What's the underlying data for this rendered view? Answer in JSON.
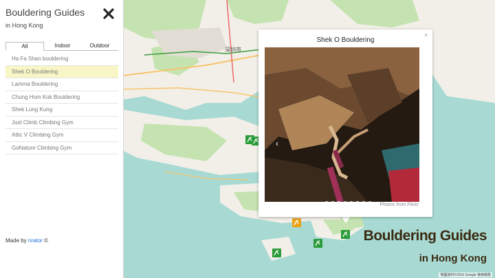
{
  "sidebar": {
    "title": "Bouldering Guides",
    "subtitle": "in Hong Kong",
    "tabs": [
      {
        "label": "All",
        "active": true
      },
      {
        "label": "Indoor",
        "active": false
      },
      {
        "label": "Outdoor",
        "active": false
      }
    ],
    "items": [
      {
        "label": "Ha Fa Shan bouldering",
        "selected": false
      },
      {
        "label": "Shek O Bouldering",
        "selected": true
      },
      {
        "label": "Lamma Bouldering",
        "selected": false
      },
      {
        "label": "Chung Hom Kok Bouldering",
        "selected": false
      },
      {
        "label": "Shek Lung Kung",
        "selected": false
      },
      {
        "label": "Just Climb Climbing Gym",
        "selected": false
      },
      {
        "label": "Attic V Climbing Gym",
        "selected": false
      },
      {
        "label": "GoNature Climbing Gym",
        "selected": false
      }
    ],
    "footer": {
      "prefix": "Made by",
      "author": "nrator",
      "suffix": "©"
    }
  },
  "map": {
    "city_label": "深圳市",
    "brand_title": "Bouldering Guides",
    "brand_subtitle": "in Hong Kong",
    "attribution": "地圖資料©2016 Google   使用條款"
  },
  "popup": {
    "title": "Shek O Bouldering",
    "close_label": "×",
    "prev_label": "‹",
    "photo_credit": "Photos from Flickr",
    "slide_count": 8,
    "active_slide": 6
  },
  "colors": {
    "water": "#a8dad3",
    "land": "#f2efe9",
    "park": "#c5e3b0",
    "marker_green": "#2c9c3a",
    "marker_orange": "#e8a317",
    "selected_row": "#f8f6c6"
  }
}
